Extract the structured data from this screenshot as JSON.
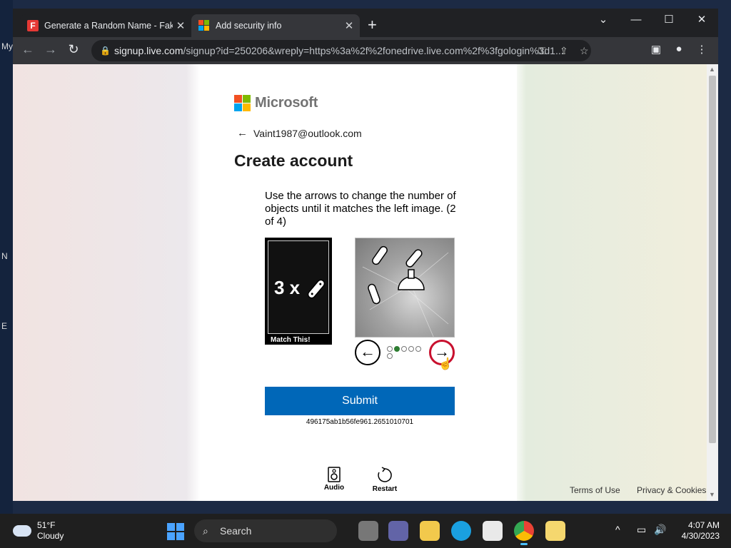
{
  "desktop": {
    "fragments": [
      "My",
      "N",
      "E"
    ]
  },
  "browser": {
    "tabs": [
      {
        "title": "Generate a Random Name - Fake",
        "icon": "fakename-favicon"
      },
      {
        "title": "Add security info",
        "icon": "microsoft-favicon"
      }
    ],
    "url": {
      "host": "signup.live.com",
      "path": "/signup?id=250206&wreply=https%3a%2f%2fonedrive.live.com%2f%3fgologin%3d1..."
    }
  },
  "page": {
    "brand": "Microsoft",
    "email": "Vaint1987@outlook.com",
    "heading": "Create account",
    "captcha": {
      "instruction": "Use the arrows to change the number of objects until it matches the left image. (2 of 4)",
      "match_text": "3 x",
      "match_label": "Match This!",
      "dots_total": 6,
      "dots_selected_index": 1,
      "submit_label": "Submit",
      "id": "496175ab1b56fe961.2651010701",
      "audio_label": "Audio",
      "restart_label": "Restart"
    },
    "footer": {
      "terms": "Terms of Use",
      "privacy": "Privacy & Cookies"
    }
  },
  "taskbar": {
    "weather_temp": "51°F",
    "weather_desc": "Cloudy",
    "search_label": "Search",
    "time": "4:07 AM",
    "date": "4/30/2023"
  },
  "colors": {
    "ms_red": "#f25022",
    "ms_green": "#7fba00",
    "ms_blue": "#00a4ef",
    "ms_yellow": "#ffb900",
    "submit_blue": "#0067b8",
    "active_arrow": "#c8102e"
  }
}
